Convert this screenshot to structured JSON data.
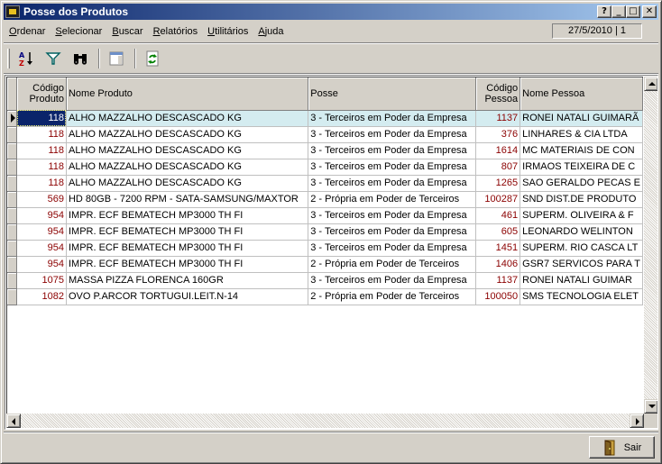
{
  "window": {
    "title": "Posse dos Produtos"
  },
  "title_buttons": {
    "help": "?",
    "minimize": "_",
    "maximize": "□",
    "close": "✕"
  },
  "menu": [
    {
      "label": "Ordenar",
      "accel": "O",
      "rest": "rdenar"
    },
    {
      "label": "Selecionar",
      "accel": "S",
      "rest": "elecionar"
    },
    {
      "label": "Buscar",
      "accel": "B",
      "rest": "uscar"
    },
    {
      "label": "Relatórios",
      "accel": "R",
      "rest": "elatórios"
    },
    {
      "label": "Utilitários",
      "accel": "U",
      "rest": "tilitários"
    },
    {
      "label": "Ajuda",
      "accel": "A",
      "rest": "juda"
    }
  ],
  "status": {
    "date_page": "27/5/2010 | 1"
  },
  "toolbar": {
    "icons": [
      "sort-az-icon",
      "filter-icon",
      "binoculars-icon",
      "window-icon",
      "refresh-icon"
    ]
  },
  "grid": {
    "columns": {
      "codigo_produto": [
        "Código",
        "Produto"
      ],
      "nome_produto": "Nome Produto",
      "posse": "Posse",
      "codigo_pessoa": [
        "Código",
        "Pessoa"
      ],
      "nome_pessoa": "Nome Pessoa"
    },
    "rows": [
      {
        "cod": "118",
        "produto": "ALHO MAZZALHO DESCASCADO KG",
        "posse": "3 - Terceiros em Poder da Empresa",
        "cod_pessoa": "1137",
        "pessoa": "RONEI NATALI GUIMARÃ"
      },
      {
        "cod": "118",
        "produto": "ALHO MAZZALHO DESCASCADO KG",
        "posse": "3 - Terceiros em Poder da Empresa",
        "cod_pessoa": "376",
        "pessoa": "LINHARES & CIA LTDA"
      },
      {
        "cod": "118",
        "produto": "ALHO MAZZALHO DESCASCADO KG",
        "posse": "3 - Terceiros em Poder da Empresa",
        "cod_pessoa": "1614",
        "pessoa": "MC MATERIAIS DE CON"
      },
      {
        "cod": "118",
        "produto": "ALHO MAZZALHO DESCASCADO KG",
        "posse": "3 - Terceiros em Poder da Empresa",
        "cod_pessoa": "807",
        "pessoa": "IRMAOS TEIXEIRA DE C"
      },
      {
        "cod": "118",
        "produto": "ALHO MAZZALHO DESCASCADO KG",
        "posse": "3 - Terceiros em Poder da Empresa",
        "cod_pessoa": "1265",
        "pessoa": "SAO GERALDO PECAS E"
      },
      {
        "cod": "569",
        "produto": "HD  80GB - 7200 RPM - SATA-SAMSUNG/MAXTOR",
        "posse": "2 - Própria em Poder de Terceiros",
        "cod_pessoa": "100287",
        "pessoa": "SND DIST.DE PRODUTO"
      },
      {
        "cod": "954",
        "produto": "IMPR. ECF BEMATECH MP3000 TH FI",
        "posse": "3 - Terceiros em Poder da Empresa",
        "cod_pessoa": "461",
        "pessoa": "SUPERM. OLIVEIRA & F"
      },
      {
        "cod": "954",
        "produto": "IMPR. ECF BEMATECH MP3000 TH FI",
        "posse": "3 - Terceiros em Poder da Empresa",
        "cod_pessoa": "605",
        "pessoa": "LEONARDO WELINTON"
      },
      {
        "cod": "954",
        "produto": "IMPR. ECF BEMATECH MP3000 TH FI",
        "posse": "3 - Terceiros em Poder da Empresa",
        "cod_pessoa": "1451",
        "pessoa": "SUPERM. RIO CASCA LT"
      },
      {
        "cod": "954",
        "produto": "IMPR. ECF BEMATECH MP3000 TH FI",
        "posse": "2 - Própria em Poder de Terceiros",
        "cod_pessoa": "1406",
        "pessoa": "GSR7 SERVICOS PARA T"
      },
      {
        "cod": "1075",
        "produto": "MASSA PIZZA FLORENCA 160GR",
        "posse": "3 - Terceiros em Poder da Empresa",
        "cod_pessoa": "1137",
        "pessoa": "RONEI NATALI GUIMAR"
      },
      {
        "cod": "1082",
        "produto": "OVO P.ARCOR TORTUGUI.LEIT.N-14",
        "posse": "2 - Própria em Poder de Terceiros",
        "cod_pessoa": "100050",
        "pessoa": "SMS TECNOLOGIA ELET"
      }
    ]
  },
  "footer": {
    "sair_label": "Sair"
  },
  "colors": {
    "title_start": "#0a246a",
    "title_end": "#a6caf0",
    "code_text": "#8b0000",
    "selected_row": "#d4ecf0"
  }
}
